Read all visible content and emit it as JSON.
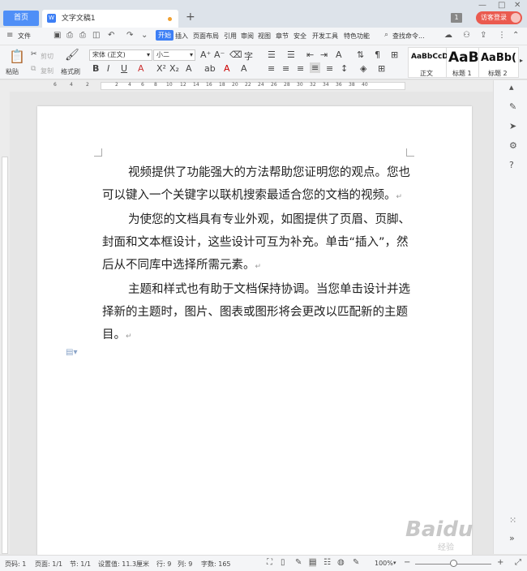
{
  "titlebar": {
    "home_tab": "首页",
    "doc_tab": "文字文稿1",
    "doc_logo": "W",
    "new_tab": "+",
    "badge": "1",
    "visitor_login": "访客登录"
  },
  "window": {
    "minimize": "—",
    "maximize": "□",
    "close": "✕"
  },
  "menu": {
    "file": "文件",
    "items": [
      "开始",
      "插入",
      "页面布局",
      "引用",
      "审阅",
      "视图",
      "章节",
      "安全",
      "开发工具",
      "特色功能"
    ],
    "search": "查找命令..."
  },
  "ribbon": {
    "paste": "粘贴",
    "cut": "剪切",
    "copy": "复制",
    "format_painter": "格式刷",
    "font_name": "宋体 (正文)",
    "font_size": "小二",
    "bold": "B",
    "italic": "I",
    "underline": "U",
    "styles": [
      {
        "preview": "AaBbCcDd",
        "label": "正文"
      },
      {
        "preview": "AaB",
        "label": "标题 1"
      },
      {
        "preview": "AaBb(",
        "label": "标题 2"
      }
    ]
  },
  "ruler": {
    "numbers": [
      "6",
      "4",
      "2",
      "2",
      "4",
      "6",
      "8",
      "10",
      "12",
      "14",
      "16",
      "18",
      "20",
      "22",
      "24",
      "26",
      "28",
      "30",
      "32",
      "34",
      "36",
      "38",
      "40"
    ]
  },
  "document": {
    "paragraphs": [
      "视频提供了功能强大的方法帮助您证明您的观点。您也可以键入一个关键字以联机搜索最适合您的文档的视频。",
      "为使您的文档具有专业外观，如图提供了页眉、页脚、封面和文本框设计，这些设计可互为补充。单击“插入”，然后从不同库中选择所需元素。",
      "主题和样式也有助于文档保持协调。当您单击设计并选择新的主题时，图片、图表或图形将会更改以匹配新的主题目。"
    ],
    "para_mark": "↵"
  },
  "statusbar": {
    "page_no": "页码: 1",
    "pages": "页面: 1/1",
    "section": "节: 1/1",
    "position": "设置值: 11.3厘米",
    "row": "行: 9",
    "col": "列: 9",
    "word_count": "字数: 165",
    "zoom": "100%",
    "zoom_out": "−",
    "zoom_in": "+"
  },
  "watermark": {
    "text": "Baidu",
    "sub": "经验"
  },
  "colors": {
    "accent": "#3d7ff5",
    "visitor": "#ea5a4f"
  }
}
